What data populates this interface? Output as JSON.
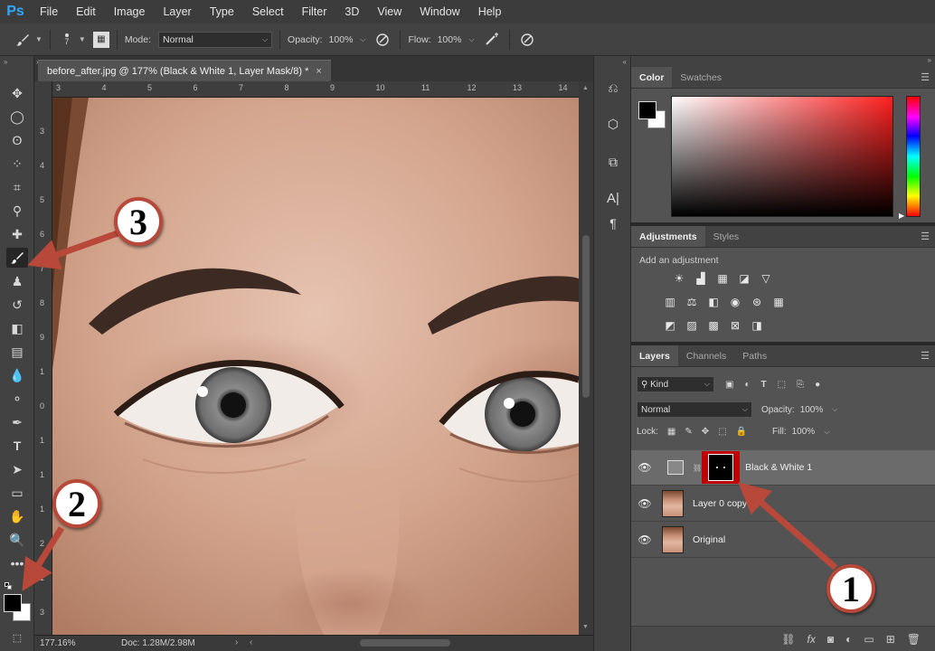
{
  "app": {
    "logo": "Ps"
  },
  "menu": [
    "File",
    "Edit",
    "Image",
    "Layer",
    "Type",
    "Select",
    "Filter",
    "3D",
    "View",
    "Window",
    "Help"
  ],
  "options": {
    "brush_size": "7",
    "mode_label": "Mode:",
    "mode_value": "Normal",
    "opacity_label": "Opacity:",
    "opacity_value": "100%",
    "flow_label": "Flow:",
    "flow_value": "100%"
  },
  "document": {
    "tab_title": "before_after.jpg @ 177% (Black & White 1, Layer Mask/8) *",
    "close": "×",
    "zoom": "177.16%",
    "doc_info": "Doc: 1.28M/2.98M",
    "hruler": [
      "3",
      "4",
      "5",
      "6",
      "7",
      "8",
      "9",
      "10",
      "11",
      "12",
      "13",
      "14"
    ],
    "vruler": [
      "3",
      "4",
      "5",
      "6",
      "7",
      "8",
      "9",
      "1",
      "0",
      "1",
      "1",
      "1",
      "2",
      "1",
      "3"
    ]
  },
  "color_panel": {
    "tabs": [
      "Color",
      "Swatches"
    ]
  },
  "adjustments": {
    "tabs": [
      "Adjustments",
      "Styles"
    ],
    "title": "Add an adjustment"
  },
  "layers": {
    "tabs": [
      "Layers",
      "Channels",
      "Paths"
    ],
    "kind_label": "Kind",
    "blend_mode": "Normal",
    "opacity_label": "Opacity:",
    "opacity_value": "100%",
    "lock_label": "Lock:",
    "fill_label": "Fill:",
    "fill_value": "100%",
    "items": [
      {
        "name": "Black & White 1",
        "selected": true
      },
      {
        "name": "Layer 0 copy",
        "selected": false
      },
      {
        "name": "Original",
        "selected": false
      }
    ]
  },
  "annotations": {
    "callout_1": "1",
    "callout_2": "2",
    "callout_3": "3",
    "accent": "#b8483a"
  },
  "colors": {
    "foreground": "#000000",
    "background": "#ffffff",
    "mask_highlight": "#c00000"
  }
}
